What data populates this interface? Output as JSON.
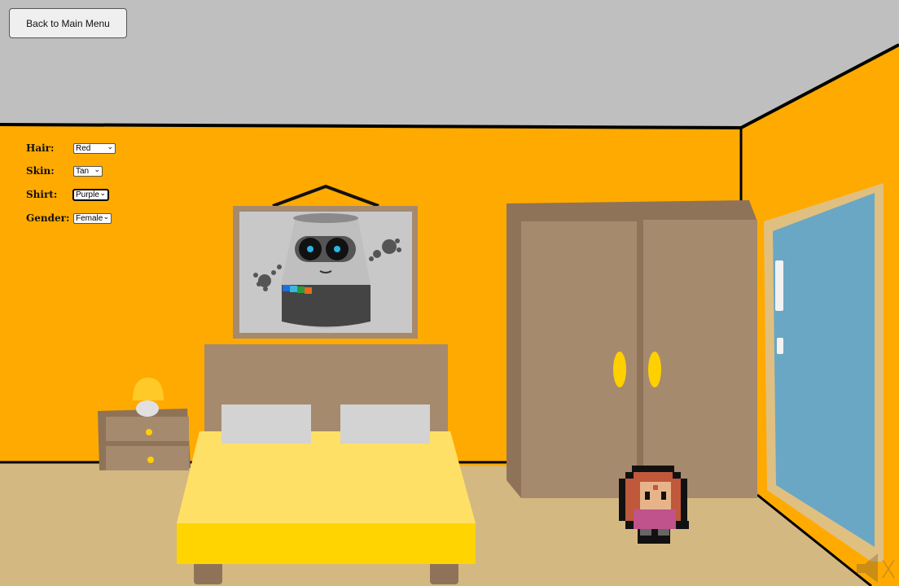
{
  "navigation": {
    "back_label": "Back to Main Menu"
  },
  "customization": {
    "hair": {
      "label": "Hair:",
      "value": "Red"
    },
    "skin": {
      "label": "Skin:",
      "value": "Tan"
    },
    "shirt": {
      "label": "Shirt:",
      "value": "Purple"
    },
    "gender": {
      "label": "Gender:",
      "value": "Female"
    }
  },
  "colors": {
    "wall": "#ffaa00",
    "ceiling": "#bfbfbf",
    "floor": "#d4b882",
    "bed_sheet": "#ffe066",
    "wardrobe": "#a68a6d",
    "window_glass": "#6aa7c4",
    "lamp_shade": "#ffc928"
  },
  "icons": {
    "sound": "speaker-muted-icon"
  }
}
